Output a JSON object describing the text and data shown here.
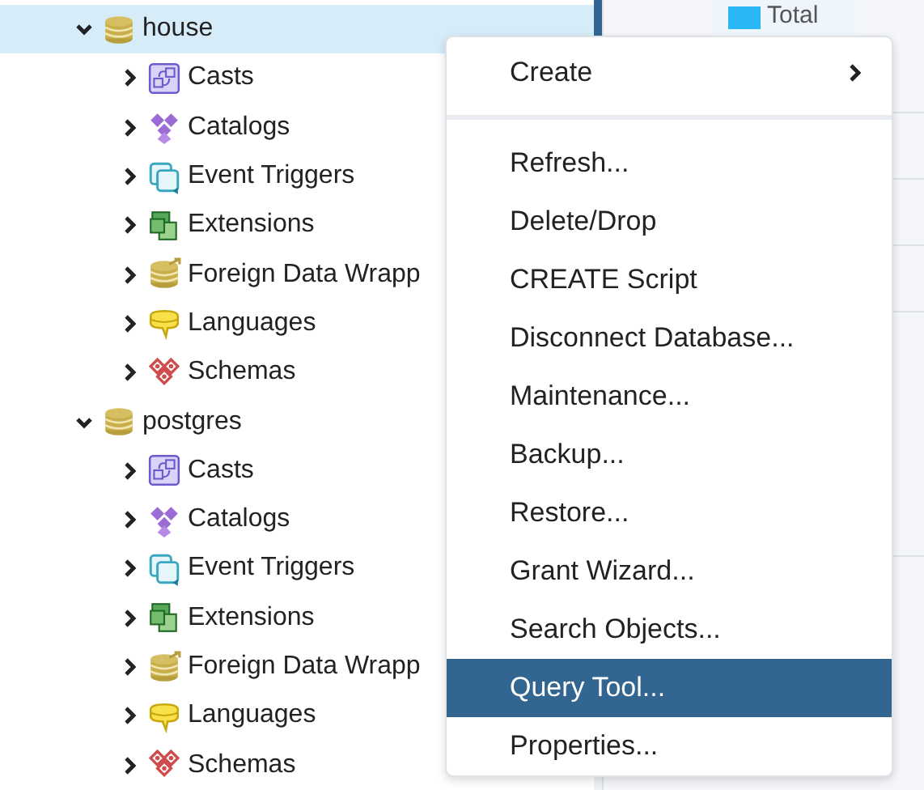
{
  "tree": [
    {
      "label": "house",
      "kind": "database",
      "expanded": true,
      "selected": true,
      "children": [
        {
          "label": "Casts",
          "kind": "casts",
          "expanded": false
        },
        {
          "label": "Catalogs",
          "kind": "catalogs",
          "expanded": false
        },
        {
          "label": "Event Triggers",
          "kind": "event_triggers",
          "expanded": false
        },
        {
          "label": "Extensions",
          "kind": "extensions",
          "expanded": false
        },
        {
          "label": "Foreign Data Wrapp",
          "kind": "fdw",
          "expanded": false
        },
        {
          "label": "Languages",
          "kind": "languages",
          "expanded": false
        },
        {
          "label": "Schemas",
          "kind": "schemas",
          "expanded": false
        }
      ]
    },
    {
      "label": "postgres",
      "kind": "database",
      "expanded": true,
      "selected": false,
      "children": [
        {
          "label": "Casts",
          "kind": "casts",
          "expanded": false
        },
        {
          "label": "Catalogs",
          "kind": "catalogs",
          "expanded": false
        },
        {
          "label": "Event Triggers",
          "kind": "event_triggers",
          "expanded": false
        },
        {
          "label": "Extensions",
          "kind": "extensions",
          "expanded": false
        },
        {
          "label": "Foreign Data Wrapp",
          "kind": "fdw",
          "expanded": false
        },
        {
          "label": "Languages",
          "kind": "languages",
          "expanded": false
        },
        {
          "label": "Schemas",
          "kind": "schemas",
          "expanded": false
        }
      ]
    }
  ],
  "chart_legend": [
    {
      "label": "Total",
      "color": "#29b6f6"
    }
  ],
  "context_menu": {
    "groups": [
      [
        {
          "label": "Create",
          "kind": "submenu",
          "selected": false
        }
      ],
      [
        {
          "label": "Refresh...",
          "kind": "item",
          "selected": false
        },
        {
          "label": "Delete/Drop",
          "kind": "item",
          "selected": false
        },
        {
          "label": "CREATE Script",
          "kind": "item",
          "selected": false
        },
        {
          "label": "Disconnect Database...",
          "kind": "item",
          "selected": false
        },
        {
          "label": "Maintenance...",
          "kind": "item",
          "selected": false
        },
        {
          "label": "Backup...",
          "kind": "item",
          "selected": false
        },
        {
          "label": "Restore...",
          "kind": "item",
          "selected": false
        },
        {
          "label": "Grant Wizard...",
          "kind": "item",
          "selected": false
        },
        {
          "label": "Search Objects...",
          "kind": "item",
          "selected": false
        },
        {
          "label": "Query Tool...",
          "kind": "item",
          "selected": true
        },
        {
          "label": "Properties...",
          "kind": "item",
          "selected": false
        }
      ]
    ]
  }
}
